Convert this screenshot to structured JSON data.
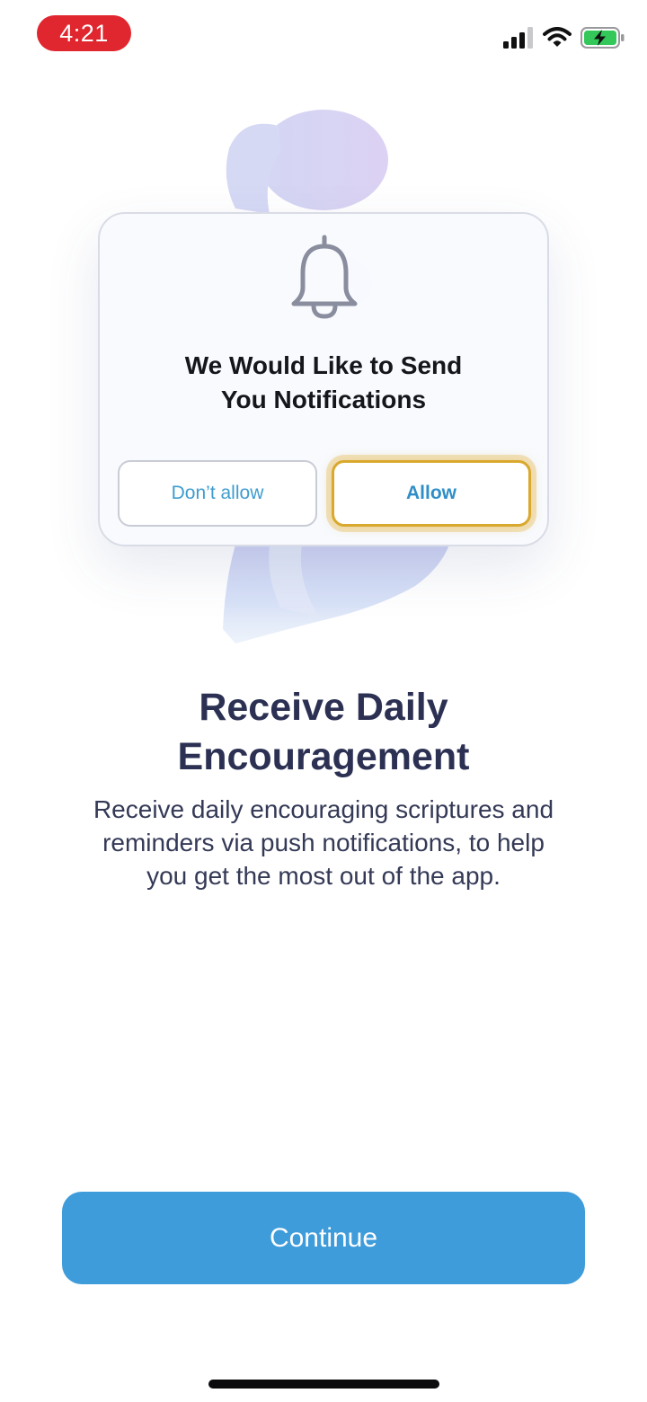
{
  "status_bar": {
    "time": "4:21",
    "icons": [
      "cellular-signal-icon",
      "wifi-icon",
      "battery-charging-icon"
    ]
  },
  "illustration": {
    "prompt_title_line1": "We Would Like to Send",
    "prompt_title_line2": "You Notifications",
    "dont_allow_label": "Don’t allow",
    "allow_label": "Allow",
    "icons": [
      "bell-icon",
      "person-silhouette"
    ]
  },
  "content": {
    "headline_line1": "Receive Daily",
    "headline_line2": "Encouragement",
    "body_line1": "Receive daily encouraging scriptures and",
    "body_line2": "reminders via push notifications, to help",
    "body_line3": "you get the most out of the app."
  },
  "footer": {
    "continue_label": "Continue"
  },
  "colors": {
    "time_pill": "#e0262e",
    "primary_button": "#3e9cdb",
    "headline": "#2c3153",
    "allow_highlight": "#d9a82e",
    "battery_fill": "#34c759"
  }
}
